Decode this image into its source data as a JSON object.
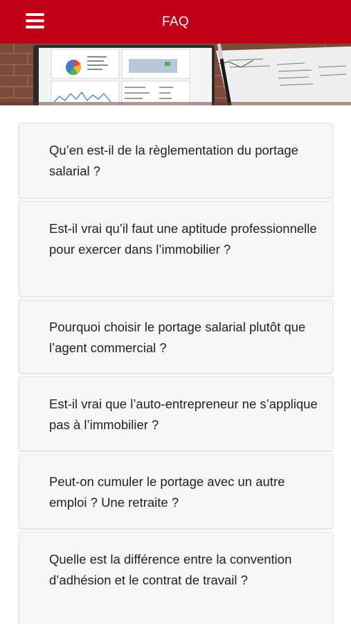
{
  "header": {
    "title": "FAQ",
    "menu_icon": "hamburger-menu-icon",
    "background_color": "#bf0016"
  },
  "faq": {
    "items": [
      {
        "question": "Qu’en est-il de la règlementation du portage salarial ?"
      },
      {
        "question": "Est-il vrai qu’il faut une aptitude professionnelle pour exercer dans l’immobilier ?"
      },
      {
        "question": "Pourquoi choisir le portage salarial plutôt que l’agent commercial ?"
      },
      {
        "question": "Est-il vrai que l’auto-entrepreneur ne s’applique pas à l’immobilier ?"
      },
      {
        "question": "Peut-on cumuler le portage avec un autre emploi ? Une retraite ?"
      },
      {
        "question": "Quelle est la différence entre la convention d’adhésion et le contrat de travail ?"
      }
    ]
  }
}
